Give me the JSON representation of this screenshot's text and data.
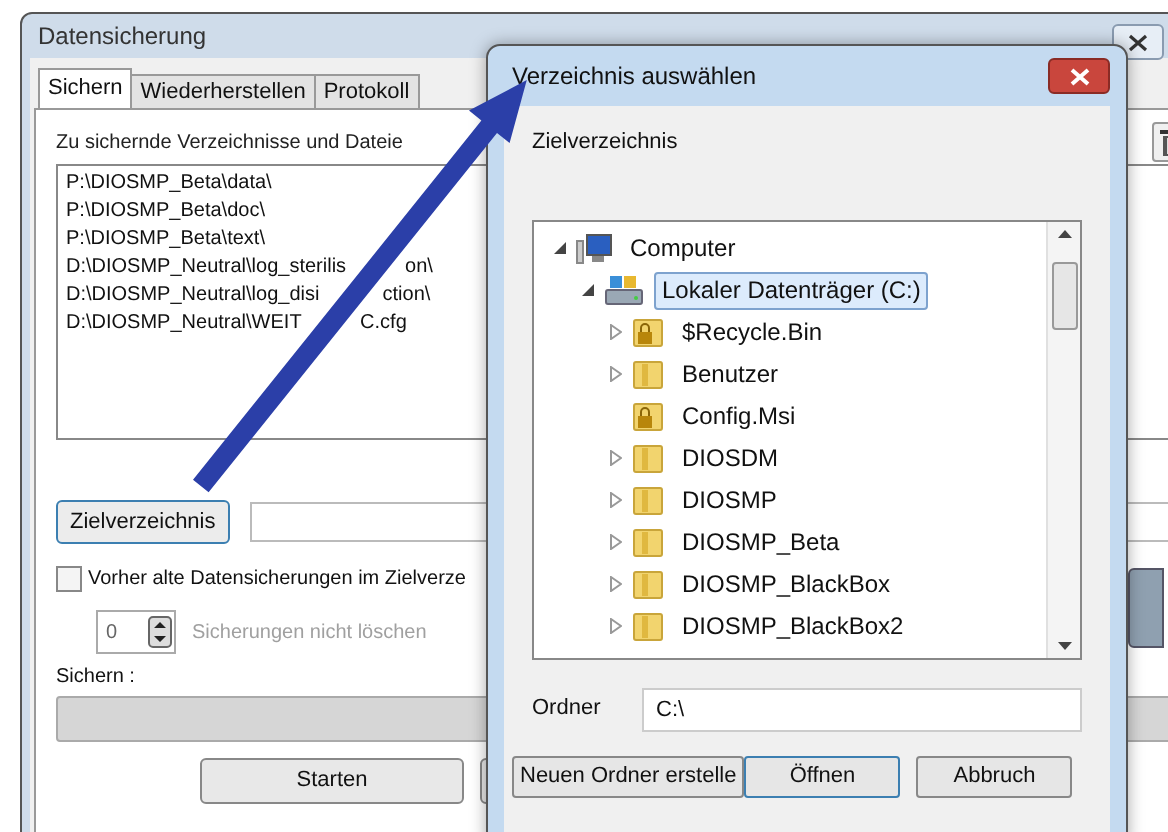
{
  "main_window": {
    "title": "Datensicherung",
    "tabs": [
      {
        "label": "Sichern",
        "selected": true
      },
      {
        "label": "Wiederherstellen",
        "selected": false
      },
      {
        "label": "Protokoll",
        "selected": false
      }
    ],
    "files_label": "Zu sichernde Verzeichnisse und Dateie",
    "files": [
      {
        "text": "P:\\DIOSMP_Beta\\data\\"
      },
      {
        "text": "P:\\DIOSMP_Beta\\doc\\"
      },
      {
        "text": "P:\\DIOSMP_Beta\\text\\"
      },
      {
        "text": "D:\\DIOSMP_Neutral\\log_sterilis",
        "text_after_arrow": "on\\"
      },
      {
        "text": "D:\\DIOSMP_Neutral\\log_disi",
        "text_after_arrow": "ction\\"
      },
      {
        "text": "D:\\DIOSMP_Neutral\\WEIT",
        "text_after_arrow": "C.cfg"
      }
    ],
    "target_button": "Zielverzeichnis",
    "delete_old": {
      "label": "Vorher alte Datensicherungen im Zielverze",
      "checked": false
    },
    "keep": {
      "value": "0",
      "label": "Sicherungen nicht löschen",
      "disabled": true
    },
    "progress": {
      "label": "Sichern :",
      "level": 0
    },
    "start_button": "Starten"
  },
  "dialog": {
    "title": "Verzeichnis auswählen",
    "caption": "Zielverzeichnis",
    "tree": [
      {
        "label": "Computer",
        "kind": "computer",
        "expanded": true,
        "selected": false,
        "children": [
          {
            "label": "Lokaler Datenträger (C:)",
            "kind": "drive",
            "expanded": true,
            "selected": true,
            "children": [
              {
                "label": "$Recycle.Bin",
                "kind": "folder",
                "expandable": true,
                "expanded": false,
                "selected": false,
                "locked": true
              },
              {
                "label": "Benutzer",
                "kind": "folder",
                "expandable": true,
                "expanded": false,
                "selected": false,
                "locked": false
              },
              {
                "label": "Config.Msi",
                "kind": "folder",
                "expandable": false,
                "expanded": false,
                "selected": false,
                "locked": true
              },
              {
                "label": "DIOSDM",
                "kind": "folder",
                "expandable": true,
                "expanded": false,
                "selected": false,
                "locked": false
              },
              {
                "label": "DIOSMP",
                "kind": "folder",
                "expandable": true,
                "expanded": false,
                "selected": false,
                "locked": false
              },
              {
                "label": "DIOSMP_Beta",
                "kind": "folder",
                "expandable": true,
                "expanded": false,
                "selected": false,
                "locked": false
              },
              {
                "label": "DIOSMP_BlackBox",
                "kind": "folder",
                "expandable": true,
                "expanded": false,
                "selected": false,
                "locked": false
              },
              {
                "label": "DIOSMP_BlackBox2",
                "kind": "folder",
                "expandable": true,
                "expanded": false,
                "selected": false,
                "locked": false
              }
            ]
          }
        ]
      }
    ],
    "folder_label": "Ordner",
    "folder_value": "C:\\",
    "buttons": [
      {
        "label": "Neuen Ordner erstelle",
        "selected": false
      },
      {
        "label": "Öffnen",
        "selected": true
      },
      {
        "label": "Abbruch",
        "selected": false
      }
    ]
  }
}
